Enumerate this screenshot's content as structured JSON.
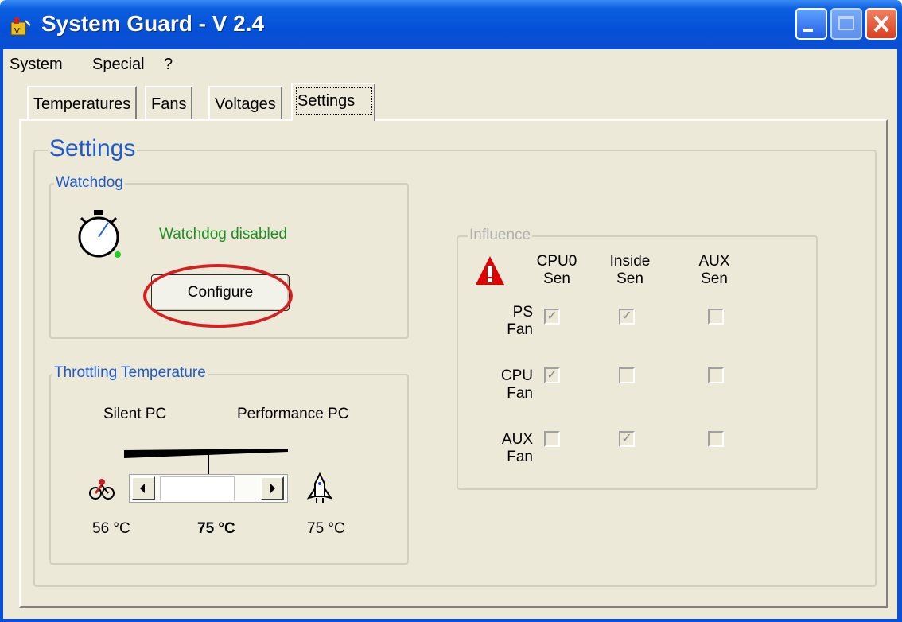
{
  "window": {
    "title": "System Guard - V 2.4"
  },
  "menu": [
    "System",
    "Special",
    "?"
  ],
  "tabs": [
    "Temperatures",
    "Fans",
    "Voltages",
    "Settings"
  ],
  "settings": {
    "title": "Settings",
    "watchdog": {
      "group_label": "Watchdog",
      "status": "Watchdog disabled",
      "configure_label": "Configure"
    },
    "throttling": {
      "group_label": "Throttling Temperature",
      "left_label": "Silent PC",
      "right_label": "Performance PC",
      "min_temp": "56 °C",
      "current_temp": "75 °C",
      "max_temp": "75 °C"
    },
    "influence": {
      "group_label": "Influence",
      "columns": [
        {
          "line1": "CPU0",
          "line2": "Sen"
        },
        {
          "line1": "Inside",
          "line2": "Sen"
        },
        {
          "line1": "AUX",
          "line2": "Sen"
        }
      ],
      "rows": [
        {
          "line1": "PS",
          "line2": "Fan",
          "checks": [
            true,
            true,
            false
          ]
        },
        {
          "line1": "CPU",
          "line2": "Fan",
          "checks": [
            true,
            false,
            false
          ]
        },
        {
          "line1": "AUX",
          "line2": "Fan",
          "checks": [
            false,
            true,
            false
          ]
        }
      ]
    }
  },
  "colors": {
    "titlebar": "#0550d8",
    "group_label": "#1f5bc8",
    "status_green": "#1e8f1e",
    "highlight_ellipse": "#d42020"
  },
  "icons": [
    "system-guard-app-icon",
    "stopwatch-icon",
    "warning-icon",
    "bicycle-icon",
    "rocket-icon"
  ]
}
